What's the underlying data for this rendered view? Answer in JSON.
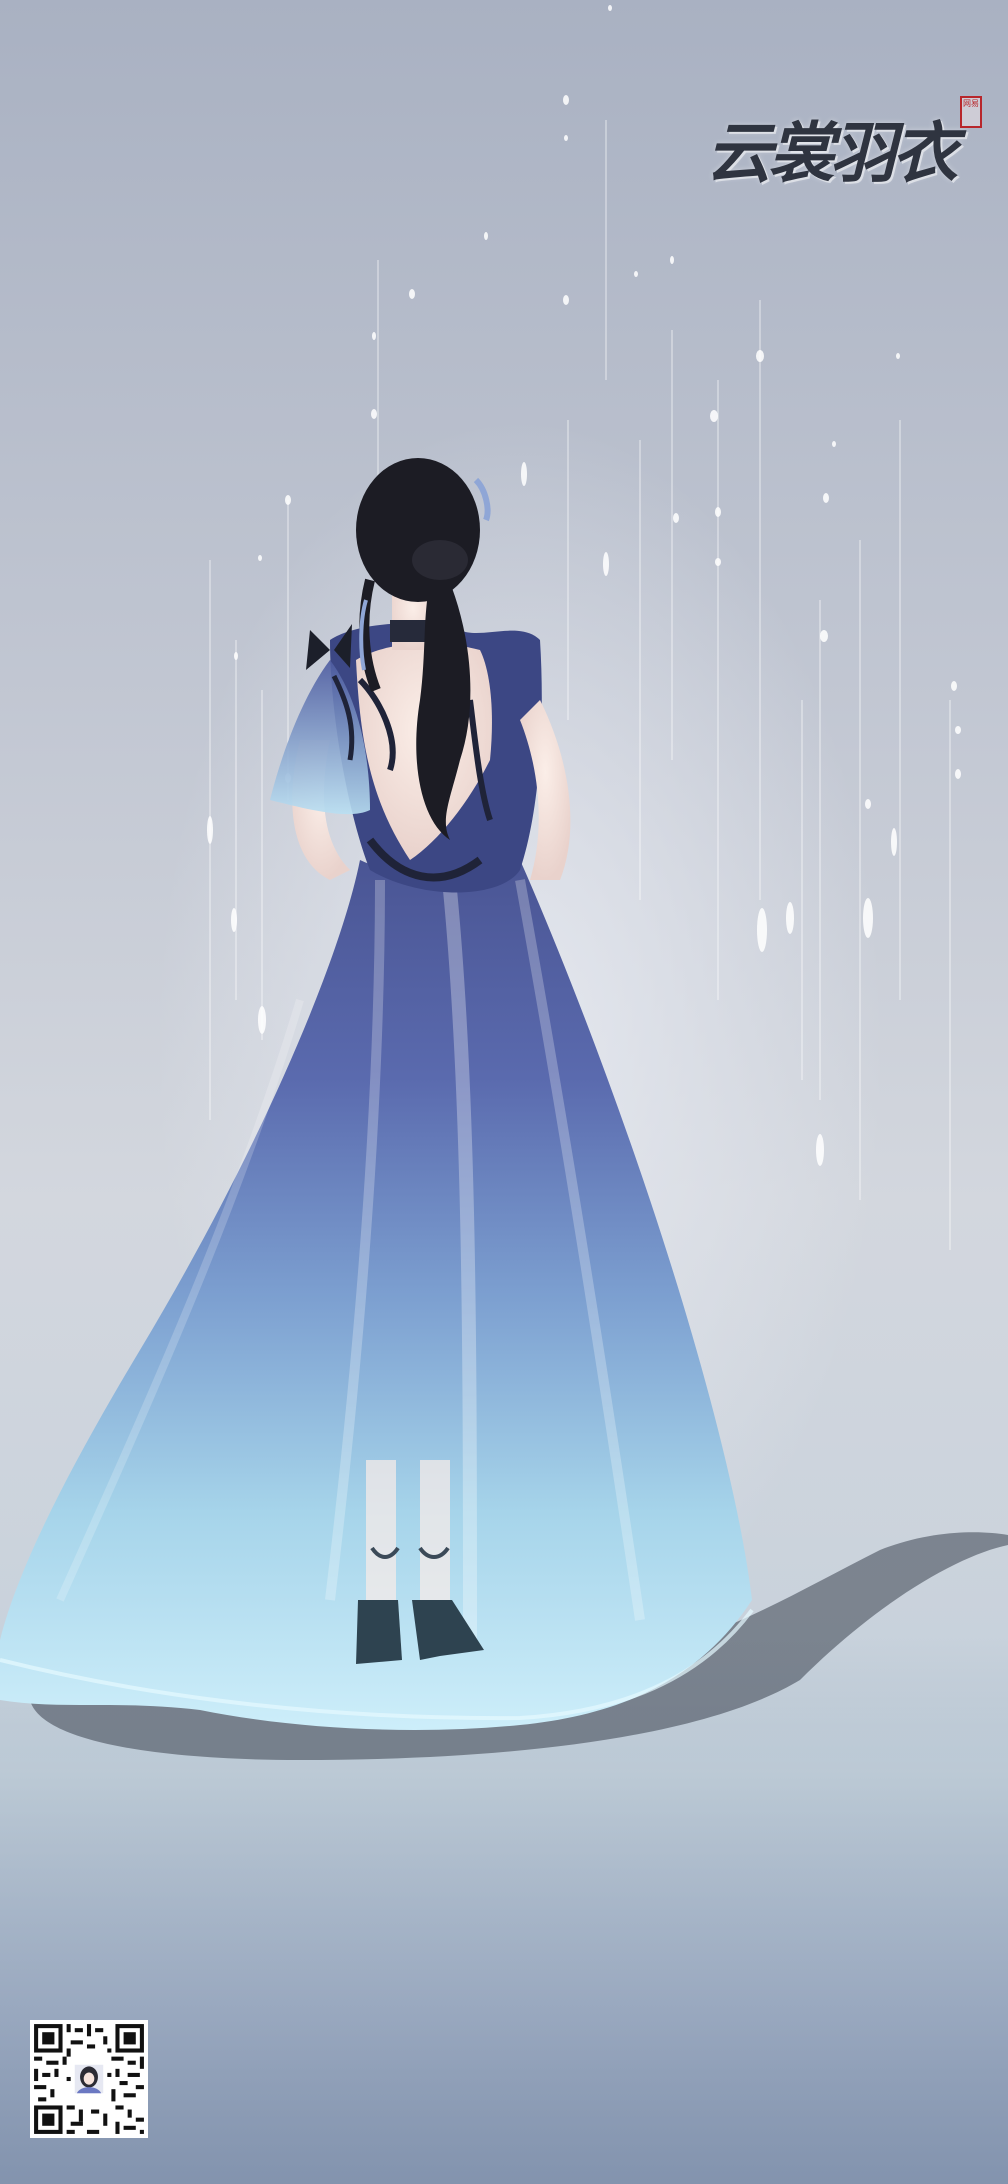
{
  "game": {
    "logo_text": "云裳羽衣",
    "seal_text": "网易"
  },
  "scene": {
    "background_top": "#a9b1c2",
    "background_bottom": "#8e9db6",
    "gown_dark": "#3f4c8c",
    "gown_light": "#bfe6f3",
    "hair": "#1c1c24"
  },
  "icons": {
    "qr": "qr-code-icon",
    "avatar": "avatar-icon"
  }
}
